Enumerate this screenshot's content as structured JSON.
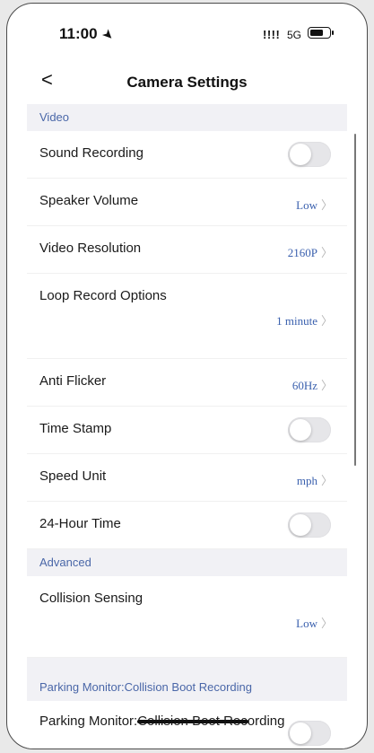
{
  "status": {
    "time": "11:00",
    "location_icon": "location-arrow-icon",
    "signal": "!!!!",
    "network": "5G",
    "battery_icon": "battery-icon"
  },
  "nav": {
    "back_icon": "chevron-left-icon",
    "back": "<",
    "title": "Camera Settings"
  },
  "sections": {
    "video": "Video",
    "advanced": "Advanced",
    "parking": "Parking Monitor:Collision Boot Recording"
  },
  "rows": {
    "sound_recording": {
      "label": "Sound Recording",
      "enabled": false
    },
    "speaker_volume": {
      "label": "Speaker Volume",
      "value": "Low"
    },
    "video_resolution": {
      "label": "Video Resolution",
      "value": "2160P"
    },
    "loop_record": {
      "label": "Loop Record Options",
      "value": "1 minute"
    },
    "anti_flicker": {
      "label": "Anti Flicker",
      "value": "60Hz"
    },
    "time_stamp": {
      "label": "Time Stamp",
      "enabled": false
    },
    "speed_unit": {
      "label": "Speed Unit",
      "value": "mph"
    },
    "hour24": {
      "label": "24-Hour Time",
      "enabled": false
    },
    "collision_sensing": {
      "label": "Collision Sensing",
      "value": "Low"
    },
    "parking_boot": {
      "label": "Parking Monitor:Collision Boot Recording",
      "enabled": false
    }
  },
  "chevron": "〉",
  "colors": {
    "accent": "#3a60ae",
    "section_bg": "#f1f1f5",
    "toggle_off": "#e6e6e9"
  }
}
